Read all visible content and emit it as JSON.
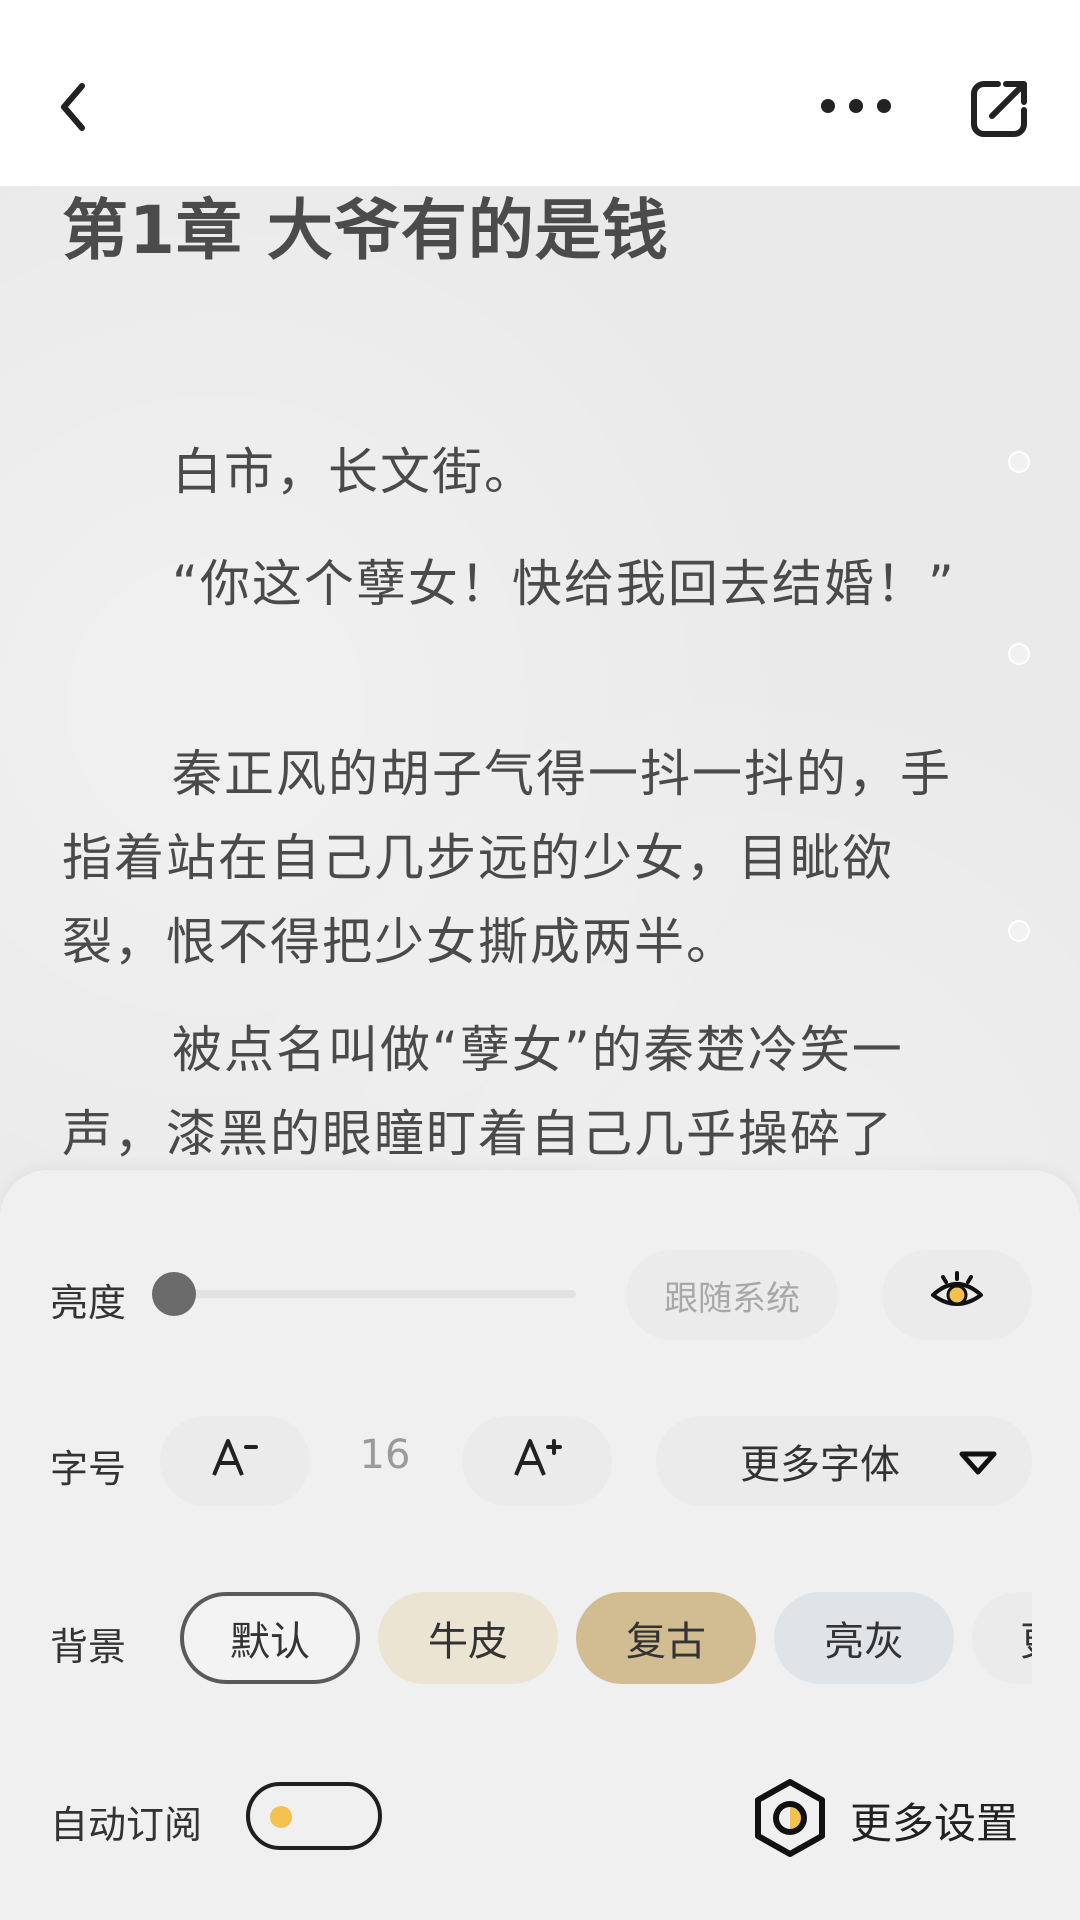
{
  "reader": {
    "chapter_title": "第1章 大爷有的是钱",
    "paragraphs": [
      "白市，长文街。",
      "“你这个孽女！快给我回去结婚！”",
      "秦正风的胡子气得一抖一抖的，手指着站在自己几步远的少女，目眦欲裂，恨不得把少女撕成两半。",
      "被点名叫做“孽女”的秦楚冷笑一声，漆黑的眼瞳盯着自己几乎操碎了"
    ]
  },
  "settings": {
    "brightness_label": "亮度",
    "brightness_level": 0,
    "follow_system": "跟随系统",
    "font_label": "字号",
    "font_size": "16",
    "more_fonts": "更多字体",
    "bg_label": "背景",
    "backgrounds": [
      "默认",
      "牛皮",
      "复古",
      "亮灰",
      "更"
    ],
    "selected_background": "默认",
    "auto_subscribe": "自动订阅",
    "auto_subscribe_on": false,
    "more_settings": "更多设置"
  },
  "colors": {
    "panel_bg": "#f0f0f0",
    "accent_yellow": "#f3c24e",
    "kraft": "#ece4d2",
    "retro": "#d2bd93",
    "gray": "#e1e4e6"
  },
  "icons": [
    "back-icon",
    "more-icon",
    "share-icon",
    "eye-protect-icon",
    "font-decrease-icon",
    "font-increase-icon",
    "dropdown-icon",
    "settings-hex-icon"
  ]
}
